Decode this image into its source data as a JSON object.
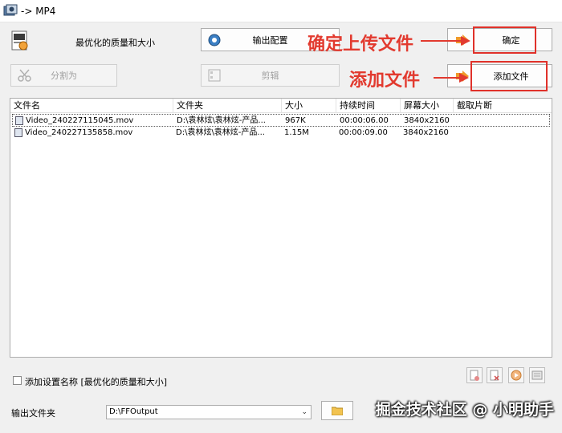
{
  "window": {
    "title": "-> MP4"
  },
  "preset": {
    "label": "最优化的质量和大小"
  },
  "buttons": {
    "output_config": "输出配置",
    "ok": "确定",
    "split": "分割为",
    "edit": "剪辑",
    "add_file": "添加文件"
  },
  "annotations": {
    "confirm_upload": "确定上传文件",
    "add_file": "添加文件"
  },
  "table": {
    "columns": [
      "文件名",
      "文件夹",
      "大小",
      "持续时间",
      "屏幕大小",
      "截取片断"
    ],
    "rows": [
      {
        "name": "Video_240227115045.mov",
        "folder": "D:\\袁林炫\\袁林炫-产品...",
        "size": "967K",
        "duration": "00:00:06.00",
        "screen": "3840x2160",
        "clip": ""
      },
      {
        "name": "Video_240227135858.mov",
        "folder": "D:\\袁林炫\\袁林炫-产品...",
        "size": "1.15M",
        "duration": "00:00:09.00",
        "screen": "3840x2160",
        "clip": ""
      }
    ]
  },
  "settings_name": {
    "label": "添加设置名称 [最优化的质量和大小]",
    "checked": false
  },
  "output_folder": {
    "label": "输出文件夹",
    "value": "D:\\FFOutput"
  },
  "watermark": "掘金技术社区 @ 小明助手",
  "colors": {
    "annotation_red": "#e23a2f",
    "selection_border": "#555555"
  }
}
